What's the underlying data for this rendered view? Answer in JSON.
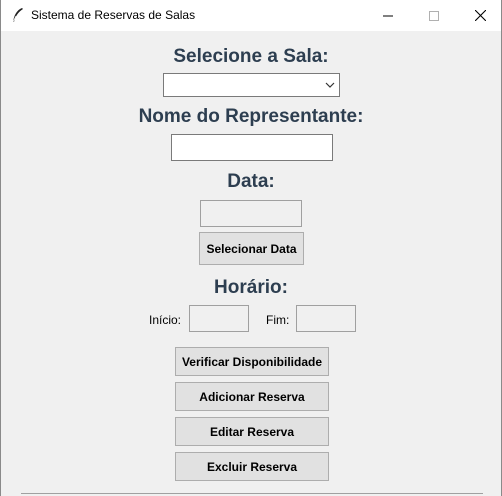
{
  "window": {
    "title": "Sistema de Reservas de Salas",
    "controls": [
      "minimize",
      "maximize",
      "close"
    ]
  },
  "form": {
    "sala_label": "Selecione a Sala:",
    "sala_value": "",
    "representante_label": "Nome do Representante:",
    "representante_value": "",
    "data_label": "Data:",
    "data_value": "",
    "selecionar_data_button": "Selecionar Data",
    "horario_label": "Horário:",
    "inicio_label": "Início:",
    "inicio_value": "",
    "fim_label": "Fim:",
    "fim_value": ""
  },
  "actions": {
    "verificar": "Verificar Disponibilidade",
    "adicionar": "Adicionar Reserva",
    "editar": "Editar Reserva",
    "excluir": "Excluir Reserva"
  },
  "colors": {
    "heading": "#2d3e50",
    "button_bg": "#e1e1e1",
    "window_bg": "#f0f0f0"
  },
  "icons": {
    "app": "feather-icon",
    "minimize": "minimize-icon",
    "maximize": "maximize-icon",
    "close": "close-icon",
    "dropdown": "chevron-down-icon"
  }
}
